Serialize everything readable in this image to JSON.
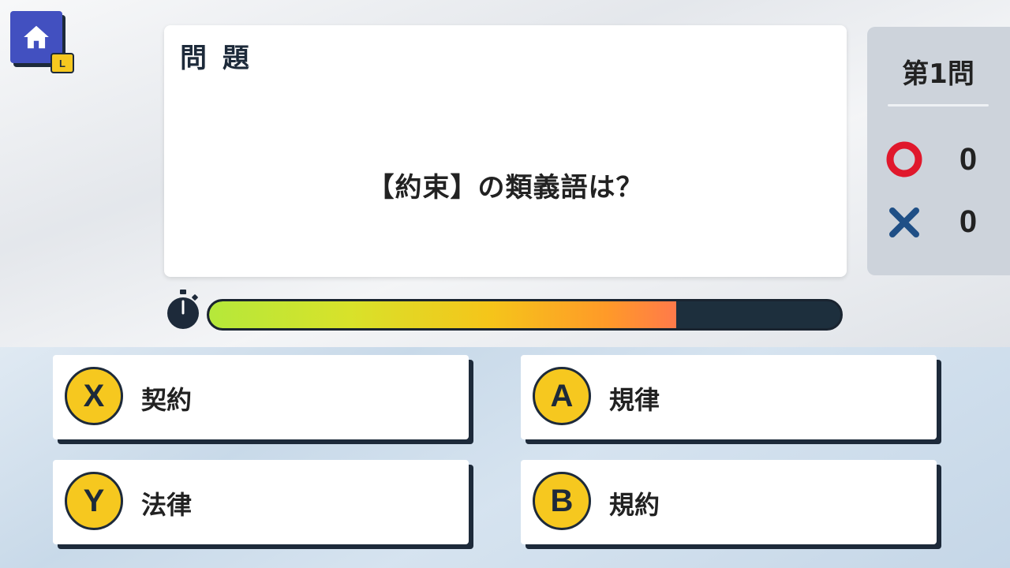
{
  "header": {
    "home_badge": "L"
  },
  "question": {
    "header": "問 題",
    "text": "【約束】の類義語は？"
  },
  "score": {
    "question_number": "第1問",
    "correct": "0",
    "incorrect": "0"
  },
  "timer": {
    "remaining_fraction": 0.74
  },
  "answers": [
    {
      "key": "X",
      "text": "契約"
    },
    {
      "key": "A",
      "text": "規律"
    },
    {
      "key": "Y",
      "text": "法律"
    },
    {
      "key": "B",
      "text": "規約"
    }
  ],
  "icons": {
    "home": "home-icon",
    "correct": "circle-icon",
    "incorrect": "cross-icon",
    "timer": "stopwatch-icon"
  },
  "colors": {
    "home_button": "#4250c0",
    "button_key": "#f6c81f",
    "correct_mark": "#e0182c",
    "incorrect_mark": "#1f4f86",
    "dark": "#1d2a3a"
  }
}
